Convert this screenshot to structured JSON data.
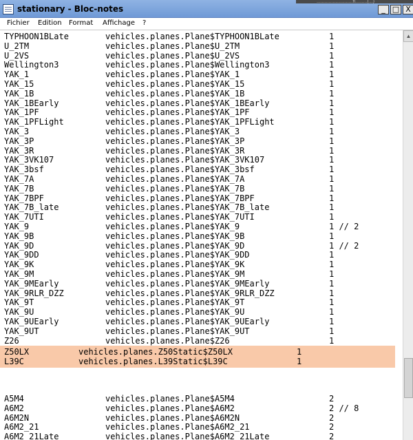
{
  "window": {
    "title": "stationary - Bloc-notes",
    "top_strip_text": "...........................fi.........(...)",
    "buttons": {
      "minimize": "_",
      "maximize": "□",
      "close": "X"
    }
  },
  "menu": [
    "Fichier",
    "Edition",
    "Format",
    "Affichage",
    "?"
  ],
  "lines": [
    {
      "name": "TYPHOON1BLate",
      "cls": "vehicles.planes.Plane$TYPHOON1BLate",
      "num": "1"
    },
    {
      "name": "U_2TM",
      "cls": "vehicles.planes.Plane$U_2TM",
      "num": "1"
    },
    {
      "name": "U_2VS",
      "cls": "vehicles.planes.Plane$U_2VS",
      "num": "1"
    },
    {
      "name": "Wellington3",
      "cls": "vehicles.planes.Plane$Wellington3",
      "num": "1"
    },
    {
      "name": "YAK_1",
      "cls": "vehicles.planes.Plane$YAK_1",
      "num": "1"
    },
    {
      "name": "YAK_15",
      "cls": "vehicles.planes.Plane$YAK_15",
      "num": "1"
    },
    {
      "name": "YAK_1B",
      "cls": "vehicles.planes.Plane$YAK_1B",
      "num": "1"
    },
    {
      "name": "YAK_1BEarly",
      "cls": "vehicles.planes.Plane$YAK_1BEarly",
      "num": "1"
    },
    {
      "name": "YAK_1PF",
      "cls": "vehicles.planes.Plane$YAK_1PF",
      "num": "1"
    },
    {
      "name": "YAK_1PFLight",
      "cls": "vehicles.planes.Plane$YAK_1PFLight",
      "num": "1"
    },
    {
      "name": "YAK_3",
      "cls": "vehicles.planes.Plane$YAK_3",
      "num": "1"
    },
    {
      "name": "YAK_3P",
      "cls": "vehicles.planes.Plane$YAK_3P",
      "num": "1"
    },
    {
      "name": "YAK_3R",
      "cls": "vehicles.planes.Plane$YAK_3R",
      "num": "1"
    },
    {
      "name": "YAK_3VK107",
      "cls": "vehicles.planes.Plane$YAK_3VK107",
      "num": "1"
    },
    {
      "name": "YAK_3bsf",
      "cls": "vehicles.planes.Plane$YAK_3bsf",
      "num": "1"
    },
    {
      "name": "YAK_7A",
      "cls": "vehicles.planes.Plane$YAK_7A",
      "num": "1"
    },
    {
      "name": "YAK_7B",
      "cls": "vehicles.planes.Plane$YAK_7B",
      "num": "1"
    },
    {
      "name": "YAK_7BPF",
      "cls": "vehicles.planes.Plane$YAK_7BPF",
      "num": "1"
    },
    {
      "name": "YAK_7B_late",
      "cls": "vehicles.planes.Plane$YAK_7B_late",
      "num": "1"
    },
    {
      "name": "YAK_7UTI",
      "cls": "vehicles.planes.Plane$YAK_7UTI",
      "num": "1"
    },
    {
      "name": "YAK_9",
      "cls": "vehicles.planes.Plane$YAK_9",
      "num": "1 // 2"
    },
    {
      "name": "YAK_9B",
      "cls": "vehicles.planes.Plane$YAK_9B",
      "num": "1"
    },
    {
      "name": "YAK_9D",
      "cls": "vehicles.planes.Plane$YAK_9D",
      "num": "1 // 2"
    },
    {
      "name": "YAK_9DD",
      "cls": "vehicles.planes.Plane$YAK_9DD",
      "num": "1"
    },
    {
      "name": "YAK_9K",
      "cls": "vehicles.planes.Plane$YAK_9K",
      "num": "1"
    },
    {
      "name": "YAK_9M",
      "cls": "vehicles.planes.Plane$YAK_9M",
      "num": "1"
    },
    {
      "name": "YAK_9MEarly",
      "cls": "vehicles.planes.Plane$YAK_9MEarly",
      "num": "1"
    },
    {
      "name": "YAK_9RLR_DZZ",
      "cls": "vehicles.planes.Plane$YAK_9RLR_DZZ",
      "num": "1"
    },
    {
      "name": "YAK_9T",
      "cls": "vehicles.planes.Plane$YAK_9T",
      "num": "1"
    },
    {
      "name": "YAK_9U",
      "cls": "vehicles.planes.Plane$YAK_9U",
      "num": "1"
    },
    {
      "name": "YAK_9UEarly",
      "cls": "vehicles.planes.Plane$YAK_9UEarly",
      "num": "1"
    },
    {
      "name": "YAK_9UT",
      "cls": "vehicles.planes.Plane$YAK_9UT",
      "num": "1"
    },
    {
      "name": "Z26",
      "cls": "vehicles.planes.Plane$Z26",
      "num": "1"
    }
  ],
  "static_lines": [
    {
      "name": "Z50LX",
      "cls": "vehicles.planes.Z50Static$Z50LX",
      "num": "1"
    },
    {
      "name": "L39C",
      "cls": "vehicles.planes.L39Static$L39C",
      "num": "1"
    }
  ],
  "lower_lines": [
    {
      "name": "A5M4",
      "cls": "vehicles.planes.Plane$A5M4",
      "num": "2"
    },
    {
      "name": "A6M2",
      "cls": "vehicles.planes.Plane$A6M2",
      "num": "2 // 8"
    },
    {
      "name": "A6M2N",
      "cls": "vehicles.planes.Plane$A6M2N",
      "num": "2"
    },
    {
      "name": "A6M2_21",
      "cls": "vehicles.planes.Plane$A6M2_21",
      "num": "2"
    },
    {
      "name": "A6M2_21Late",
      "cls": "vehicles.planes.Plane$A6M2_21Late",
      "num": "2"
    }
  ],
  "colors": {
    "titlebar": "#7ea6dd",
    "highlight": "#f9c9a9",
    "editor_bg": "#ffffff",
    "text": "#000000"
  }
}
